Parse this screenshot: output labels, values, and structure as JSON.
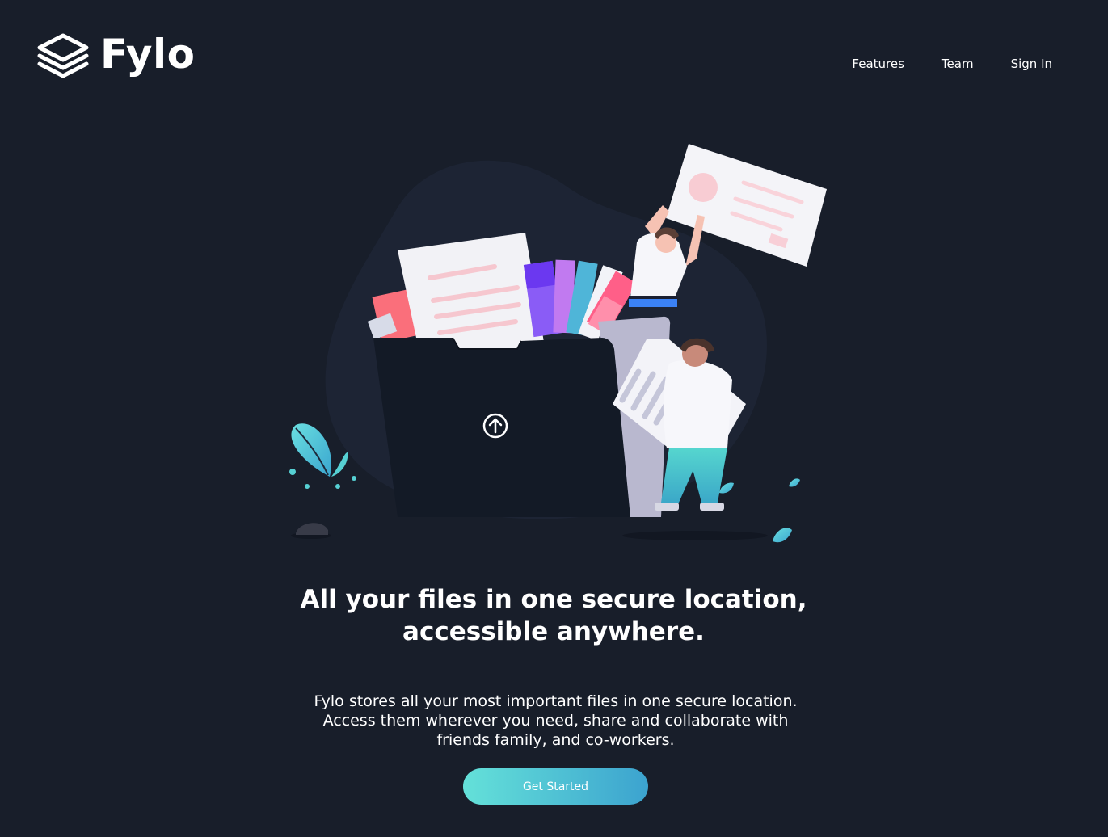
{
  "header": {
    "logo_text": "Fylo",
    "logo_icon": "stacked-layers-icon"
  },
  "nav": {
    "items": [
      {
        "label": "Features"
      },
      {
        "label": "Team"
      },
      {
        "label": "Sign In"
      }
    ]
  },
  "hero": {
    "illustration_icon": "upload-arrow-icon",
    "headline_line1": "All your files in one secure location,",
    "headline_line2": "accessible anywhere.",
    "description": "Fylo stores all your most important files in one secure location. Access them wherever you need, share and collaborate with friends family, and co-workers.",
    "cta_label": "Get Started"
  },
  "colors": {
    "background": "#181e2a",
    "cta_gradient_start": "#64e1d9",
    "cta_gradient_end": "#3ca3cf",
    "text": "#ffffff"
  }
}
